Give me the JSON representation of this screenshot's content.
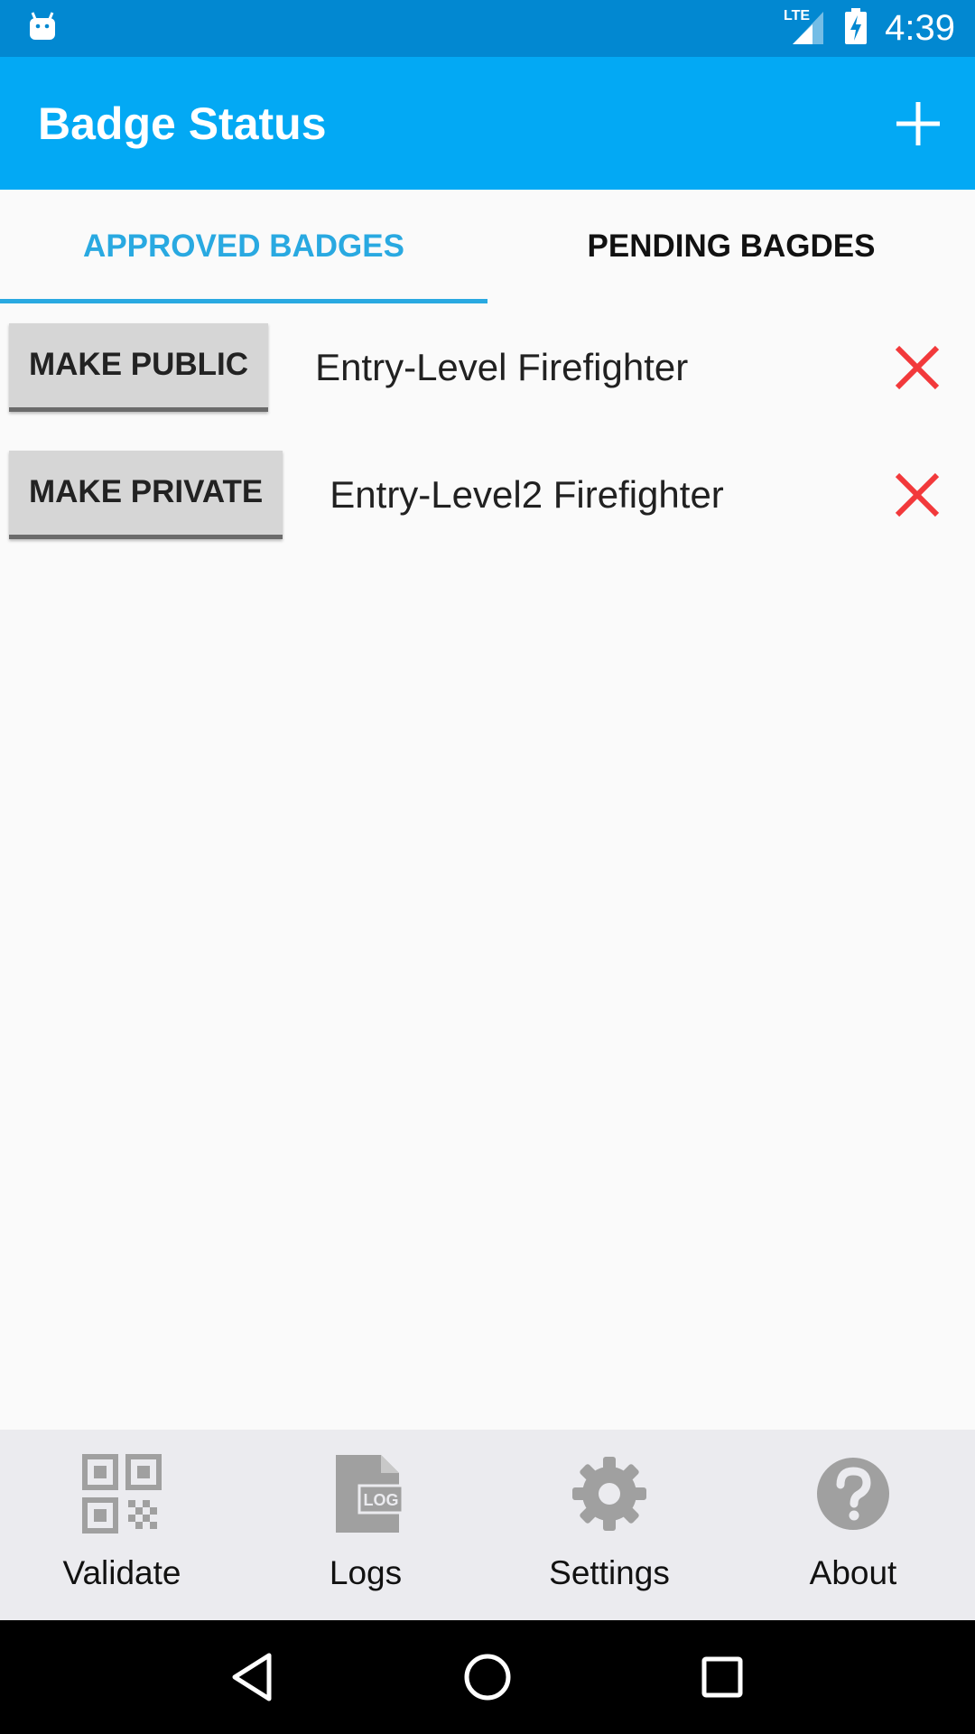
{
  "status_bar": {
    "time": "4:39",
    "network_label": "LTE",
    "icons": [
      "android-icon",
      "signal-icon",
      "battery-charging-icon"
    ]
  },
  "app_bar": {
    "title": "Badge Status",
    "add_icon": "plus-icon"
  },
  "tabs": [
    {
      "label": "APPROVED BADGES",
      "active": true
    },
    {
      "label": "PENDING BAGDES",
      "active": false
    }
  ],
  "badges": [
    {
      "button_label": "MAKE PUBLIC",
      "name": "Entry-Level Firefighter",
      "remove_icon": "close-icon"
    },
    {
      "button_label": "MAKE PRIVATE",
      "name": "Entry-Level2 Firefighter",
      "remove_icon": "close-icon"
    }
  ],
  "bottom_nav": [
    {
      "label": "Validate",
      "icon": "qr-code-icon"
    },
    {
      "label": "Logs",
      "icon": "log-file-icon",
      "icon_text": "LOG"
    },
    {
      "label": "Settings",
      "icon": "gear-icon"
    },
    {
      "label": "About",
      "icon": "help-icon"
    }
  ],
  "colors": {
    "status_bar": "#0288d1",
    "app_bar": "#03a9f4",
    "tab_active": "#29a9e1",
    "remove": "#f2393b",
    "nav_icon": "#a0a0a0"
  }
}
